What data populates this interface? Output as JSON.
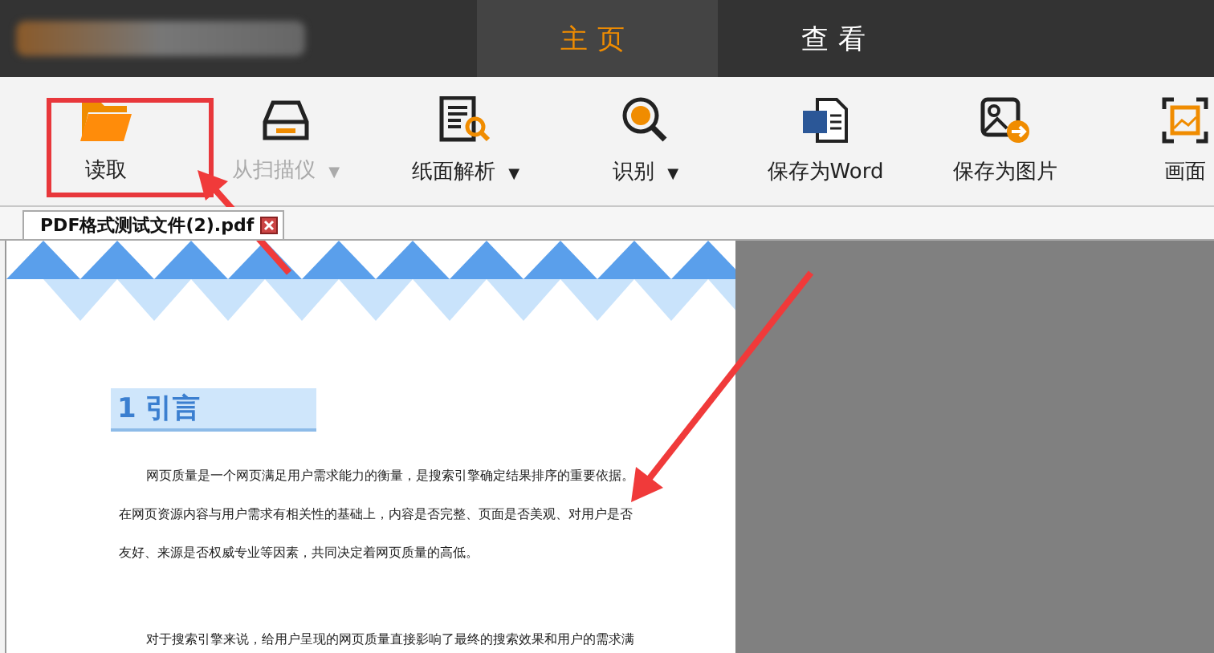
{
  "title_bar": {
    "tabs": [
      {
        "label": "主页",
        "selected": true
      },
      {
        "label": "查看",
        "selected": false
      }
    ]
  },
  "toolbar": {
    "buttons": [
      {
        "label": "读取",
        "kind": "folder",
        "disabled": false
      },
      {
        "label": "从扫描仪",
        "kind": "scanner",
        "caret": "▼",
        "disabled": true
      },
      {
        "label": "纸面解析",
        "kind": "document",
        "caret": "▼",
        "disabled": false
      },
      {
        "label": "识别",
        "kind": "recognize",
        "caret": "▼",
        "disabled": false
      },
      {
        "label": "保存为Word",
        "kind": "word",
        "disabled": false
      },
      {
        "label": "保存为图片",
        "kind": "image",
        "disabled": false
      },
      {
        "label": "画面",
        "kind": "capture",
        "disabled": false
      }
    ]
  },
  "document_tab": {
    "label": "PDF格式测试文件(2).pdf"
  },
  "document": {
    "heading_number": "1",
    "heading": "引言",
    "paragraphs": [
      {
        "lines": [
          "网页质量是一个网页满足用户需求能力的衡量，是搜索引擎确定结果排序的重要依据。",
          "在网页资源内容与用户需求有相关性的基础上，内容是否完整、页面是否美观、对用户是否",
          "友好、来源是否权威专业等因素，共同决定着网页质量的高低。"
        ]
      },
      {
        "lines": [
          "对于搜索引擎来说，给用户呈现的网页质量直接影响了最终的搜索效果和用户的需求满"
        ]
      }
    ]
  }
}
